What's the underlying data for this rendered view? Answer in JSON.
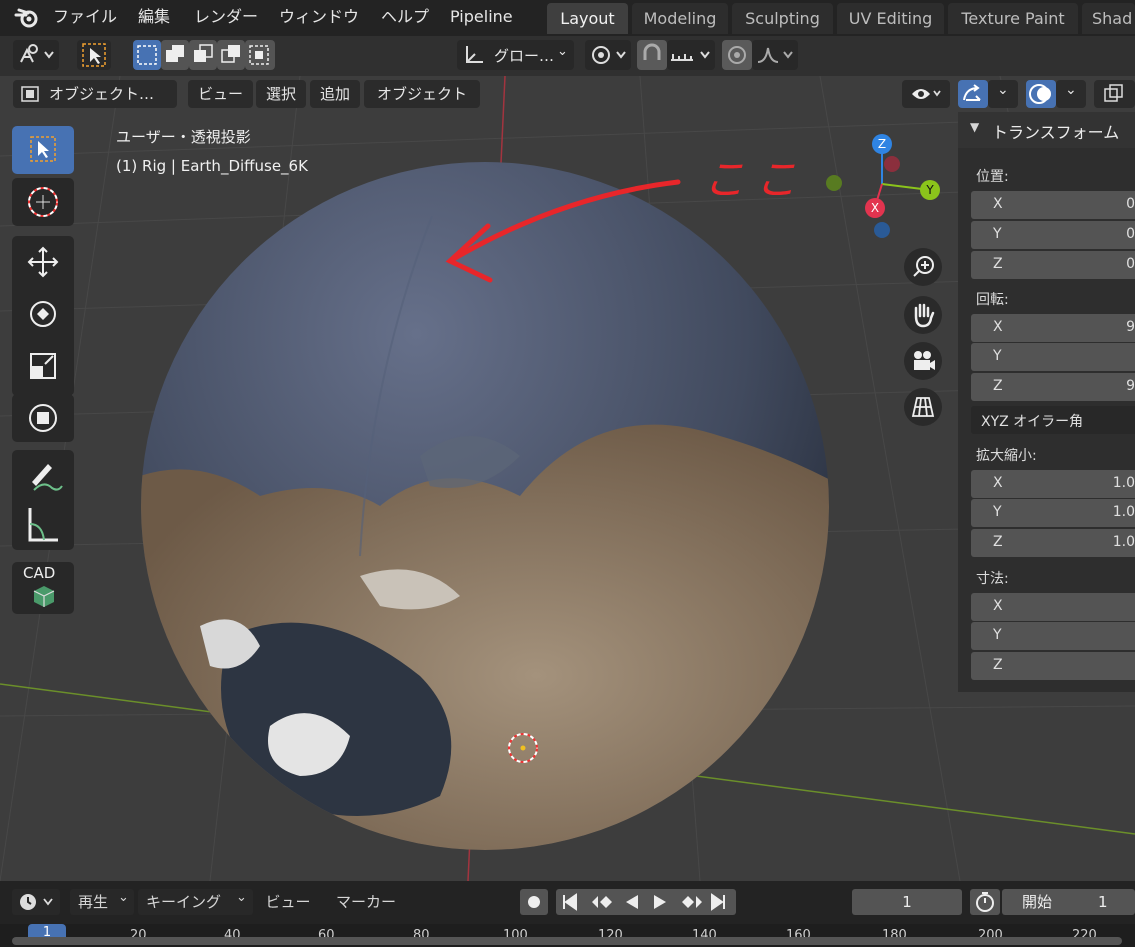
{
  "menu": {
    "items": [
      "ファイル",
      "編集",
      "レンダー",
      "ウィンドウ",
      "ヘルプ",
      "Pipeline"
    ]
  },
  "workspaces": [
    "Layout",
    "Modeling",
    "Sculpting",
    "UV Editing",
    "Texture Paint",
    "Shad"
  ],
  "header": {
    "transform_orientation": "グロー…",
    "mode": "オブジェクト…",
    "view": "ビュー",
    "select": "選択",
    "add": "追加",
    "object": "オブジェクト"
  },
  "viewport": {
    "title": "ユーザー・透視投影",
    "subtitle": "(1) Rig | Earth_Diffuse_6K",
    "annotation_text": "ここ"
  },
  "toolbar": {
    "cad_label": "CAD"
  },
  "gizmo": {
    "z": "Z",
    "y": "Y",
    "x": "X",
    "colors": {
      "z": "#2f84e3",
      "y": "#8bc41b",
      "x": "#e2344f"
    }
  },
  "npanel": {
    "title": "トランスフォーム",
    "location_label": "位置:",
    "location": [
      {
        "axis": "X",
        "value": "0"
      },
      {
        "axis": "Y",
        "value": "0"
      },
      {
        "axis": "Z",
        "value": "0"
      }
    ],
    "rotation_label": "回転:",
    "rotation": [
      {
        "axis": "X",
        "value": "9"
      },
      {
        "axis": "Y",
        "value": ""
      },
      {
        "axis": "Z",
        "value": "9"
      }
    ],
    "rotation_mode": "XYZ オイラー角",
    "scale_label": "拡大縮小:",
    "scale": [
      {
        "axis": "X",
        "value": "1.0"
      },
      {
        "axis": "Y",
        "value": "1.0"
      },
      {
        "axis": "Z",
        "value": "1.0"
      }
    ],
    "dimensions_label": "寸法:",
    "dimensions": [
      {
        "axis": "X",
        "value": ""
      },
      {
        "axis": "Y",
        "value": ""
      },
      {
        "axis": "Z",
        "value": ""
      }
    ]
  },
  "timeline": {
    "playback": "再生",
    "keying": "キーイング",
    "view": "ビュー",
    "marker": "マーカー",
    "current_frame": "1",
    "start_label": "開始",
    "start_value": "1",
    "ruler": [
      "1",
      "20",
      "40",
      "60",
      "80",
      "100",
      "120",
      "140",
      "160",
      "180",
      "200",
      "220"
    ]
  },
  "colors": {
    "accent": "#4772b3",
    "annotation": "#e8262a"
  }
}
